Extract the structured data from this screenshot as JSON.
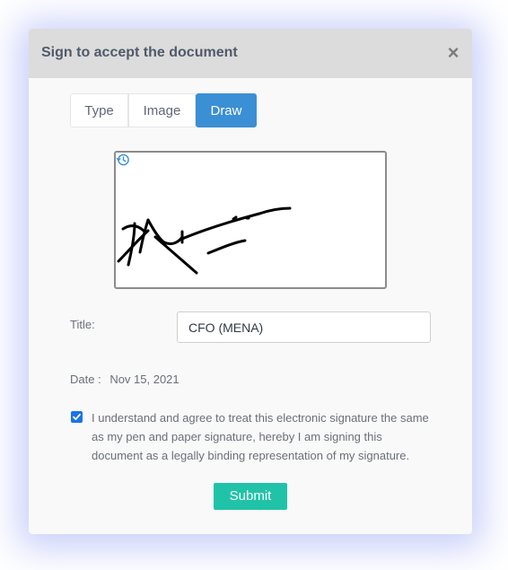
{
  "dialog": {
    "title": "Sign to accept the document",
    "close_glyph": "×"
  },
  "tabs": [
    {
      "label": "Type",
      "active": false
    },
    {
      "label": "Image",
      "active": false
    },
    {
      "label": "Draw",
      "active": true
    }
  ],
  "signature_pad": {
    "history_icon": "history-icon"
  },
  "form": {
    "title_label": "Title:",
    "title_value": "CFO (MENA)",
    "date_label": "Date :",
    "date_value": "Nov 15, 2021"
  },
  "consent": {
    "checked": true,
    "text": "I understand and agree to treat this electronic signature the same as my pen and paper signature, hereby I am signing this document as a legally binding representation of my signature."
  },
  "actions": {
    "submit_label": "Submit"
  },
  "colors": {
    "accent_tab": "#3b8fd4",
    "submit": "#21c3a8",
    "checkbox": "#1a73e8"
  }
}
